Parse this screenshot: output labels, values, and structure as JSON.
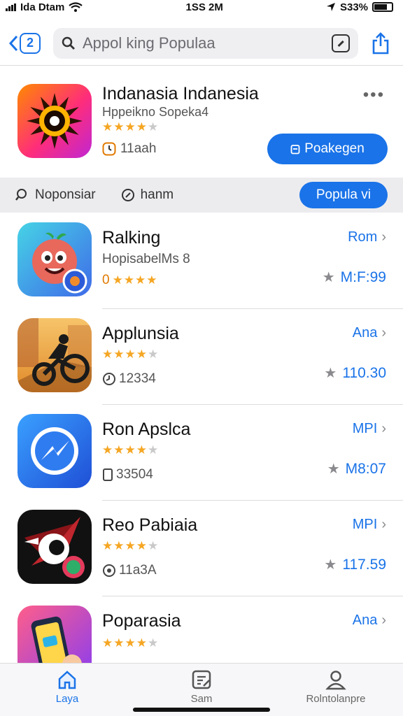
{
  "status": {
    "carrier": "Ida Dtam",
    "time": "1SS 2M",
    "battery": "S33%"
  },
  "search": {
    "back_label": "2",
    "query": "Appol king Populaa"
  },
  "featured": {
    "title": "Indanasia Indanesia",
    "subtitle": "Hppeikno Sopeka4",
    "rating": 4,
    "meta": "11aah",
    "more": "•••",
    "cta_label": "Poakegen"
  },
  "filters": {
    "item1": "Noponsiar",
    "item2": "hanm",
    "pill": "Popula vi"
  },
  "apps": [
    {
      "name": "Ralking",
      "subtitle": "HopisabelMs 8",
      "rating": 4,
      "meta": "0",
      "link": "Rom",
      "price": "M:F:99"
    },
    {
      "name": "Applunsia",
      "rating": 4,
      "meta": "12334",
      "link": "Ana",
      "price": "110.30"
    },
    {
      "name": "Ron Apslca",
      "rating": 4,
      "meta": "33504",
      "link": "MPI",
      "price": "M8:07"
    },
    {
      "name": "Reo Pabiaia",
      "rating": 4,
      "meta": "11a3A",
      "link": "MPI",
      "price": "117.59"
    },
    {
      "name": "Poparasia",
      "rating": 4,
      "link": "Ana"
    }
  ],
  "tabs": [
    {
      "label": "Laya",
      "icon": "home-icon"
    },
    {
      "label": "Sam",
      "icon": "edit-icon"
    },
    {
      "label": "Rolntolanpre",
      "icon": "person-icon"
    }
  ],
  "colors": {
    "accent": "#1a73e8",
    "star": "#f5a623"
  }
}
